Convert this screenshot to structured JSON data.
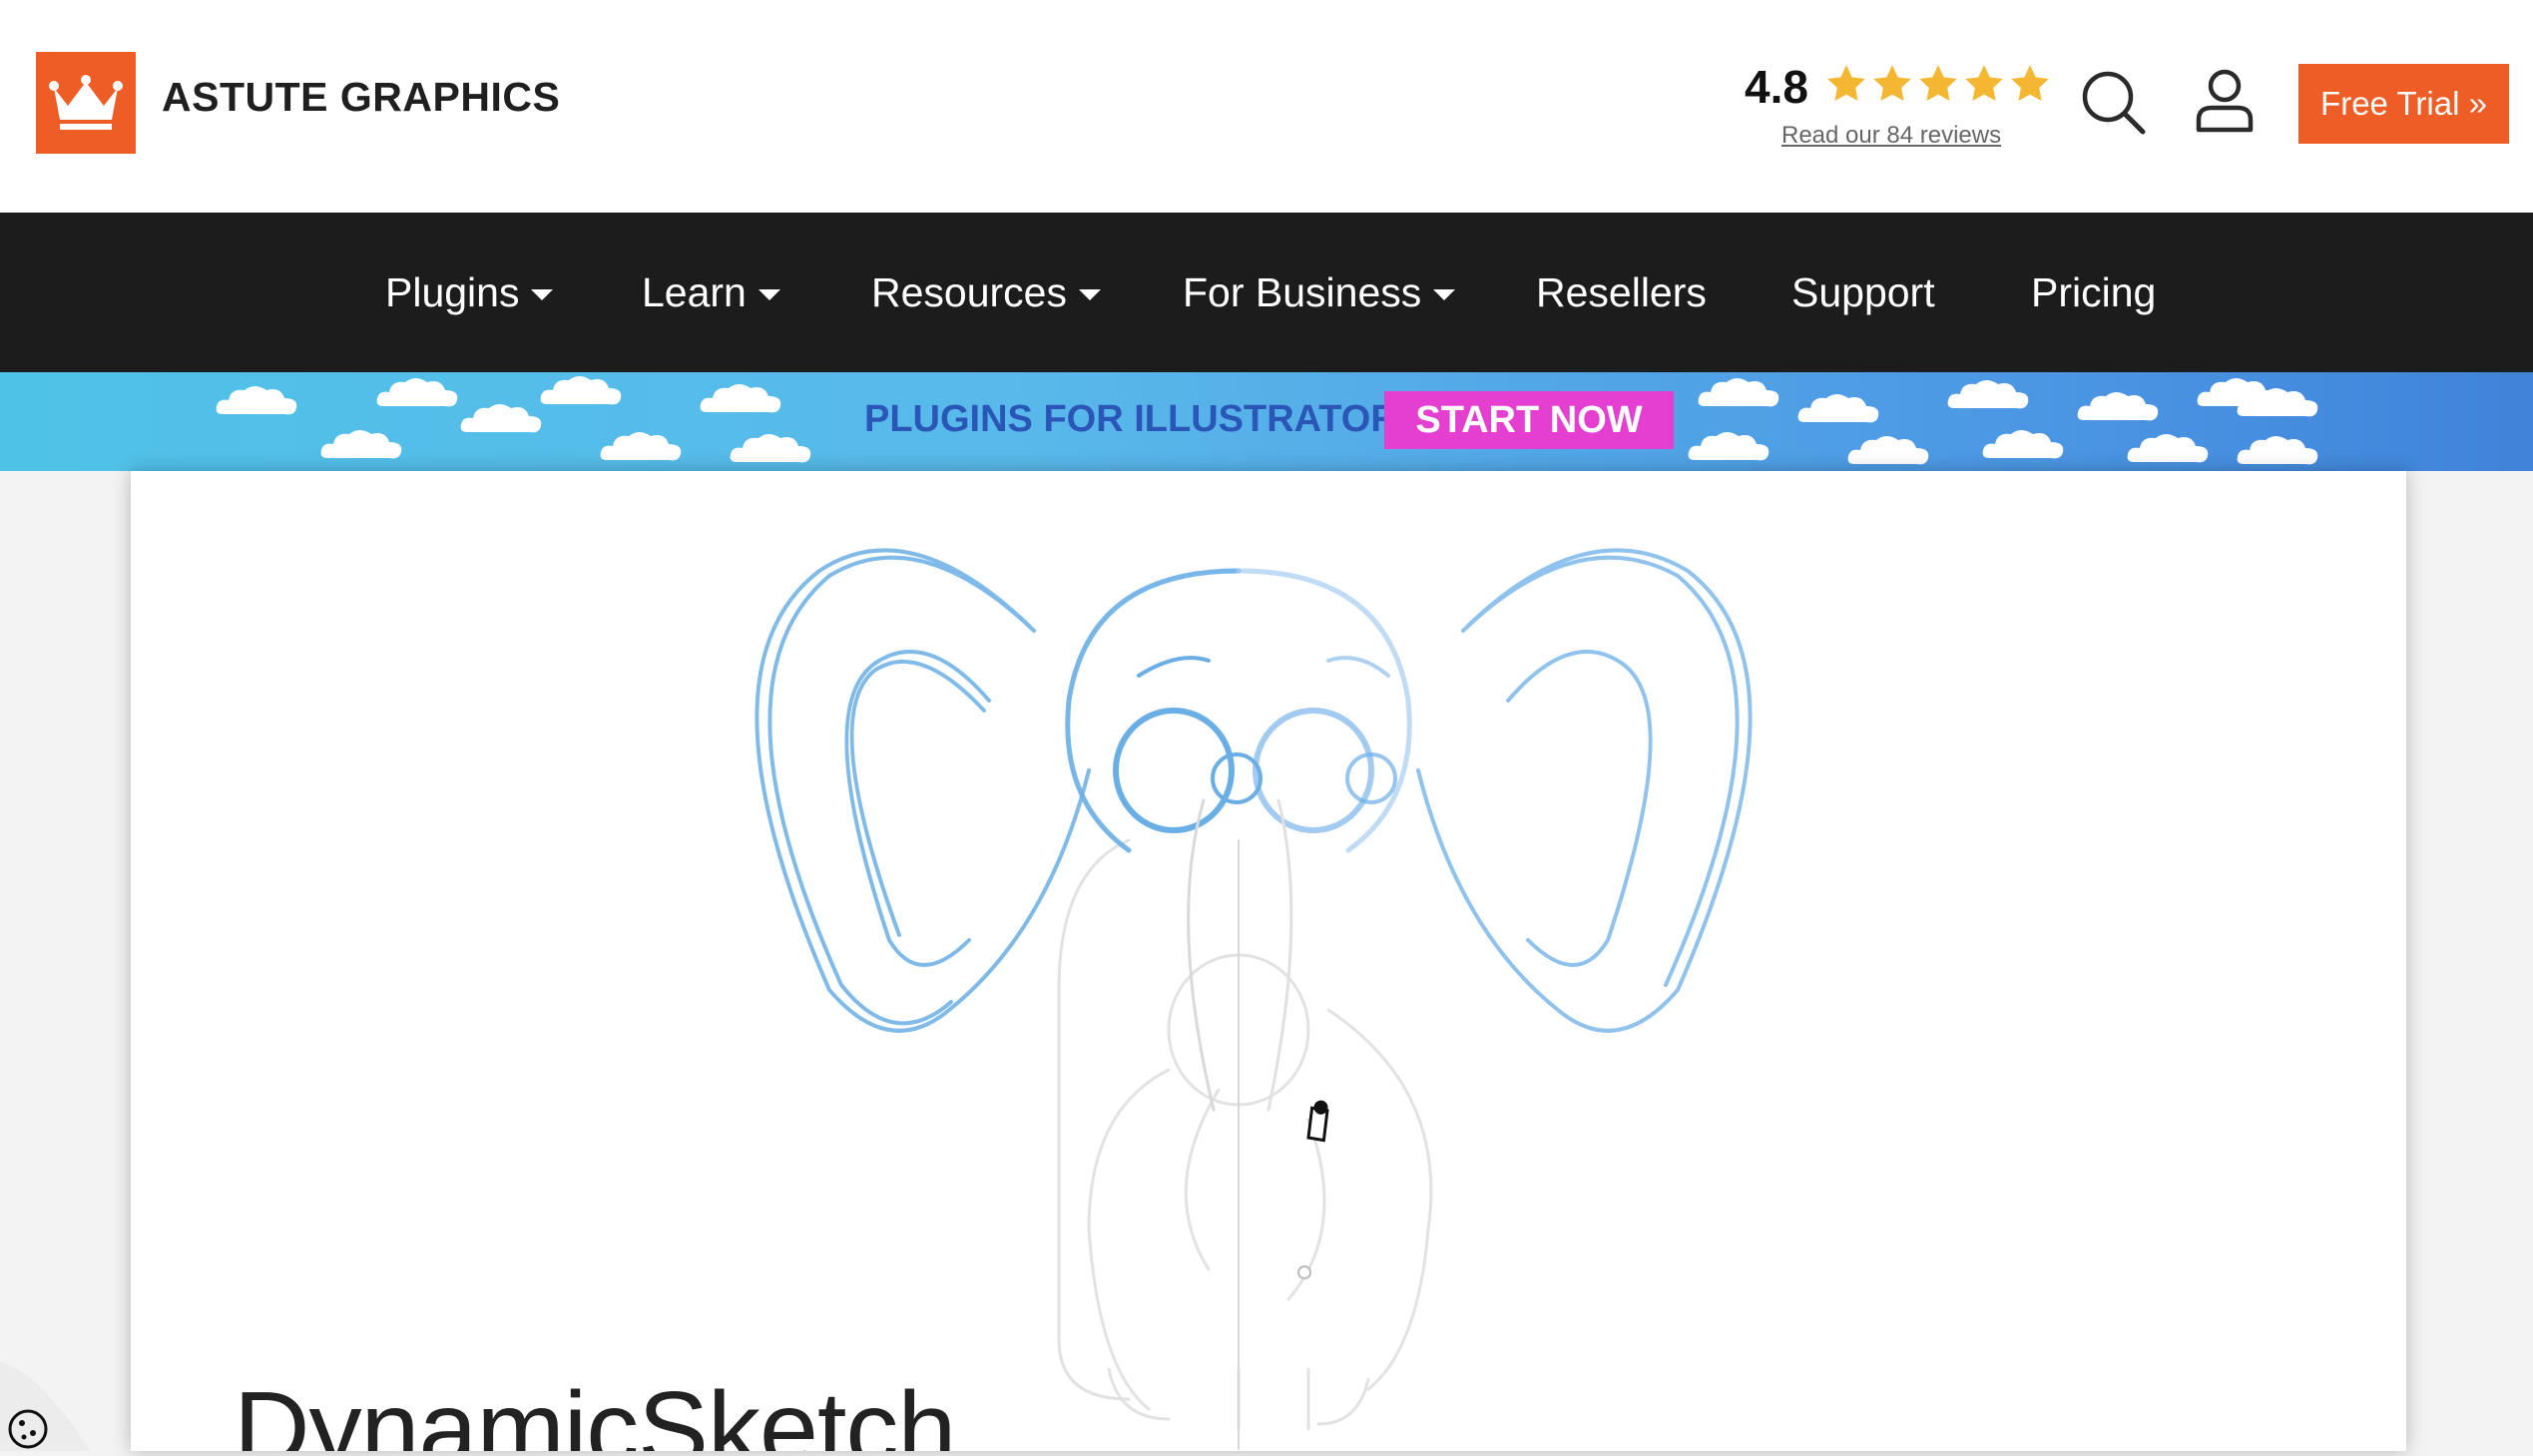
{
  "header": {
    "brand_name": "ASTUTE GRAPHICS",
    "logo_icon": "crown-icon",
    "rating_value": "4.8",
    "rating_stars": 5,
    "reviews_link": "Read our 84 reviews",
    "search_icon": "search-icon",
    "account_icon": "user-icon",
    "trial_button": "Free Trial »"
  },
  "nav": {
    "items": [
      {
        "label": "Plugins",
        "dropdown": true
      },
      {
        "label": "Learn",
        "dropdown": true
      },
      {
        "label": "Resources",
        "dropdown": true
      },
      {
        "label": "For Business",
        "dropdown": true
      },
      {
        "label": "Resellers",
        "dropdown": false
      },
      {
        "label": "Support",
        "dropdown": false
      },
      {
        "label": "Pricing",
        "dropdown": false
      }
    ]
  },
  "banner": {
    "text": "PLUGINS FOR ILLUSTRATOR",
    "button": "START NOW"
  },
  "main": {
    "product_title": "DynamicSketch"
  },
  "cookie": {
    "icon": "cookie-icon"
  },
  "colors": {
    "brand": "#ee5d25",
    "nav_bg": "#1c1c1c",
    "banner_text": "#2a56b8",
    "banner_button": "#e43fd0",
    "star": "#f5b731",
    "sketch_line": "#6aaee6"
  }
}
